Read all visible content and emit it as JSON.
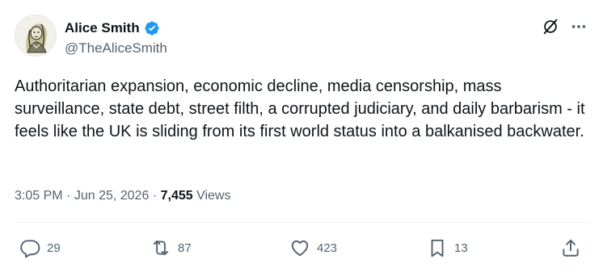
{
  "author": {
    "display_name": "Alice Smith",
    "handle": "@TheAliceSmith",
    "verified": true,
    "verified_color": "#1d9bf0"
  },
  "tweet": {
    "text": "Authoritarian expansion, economic decline, media censorship, mass surveillance, state debt, street filth, a corrupted judiciary, and daily barbarism - it feels like the UK is sliding from its first world status into a balkanised backwater.",
    "time": "3:05 PM",
    "separator": "·",
    "date": "Jun 25, 2026",
    "views_count": "7,455",
    "views_label": "Views"
  },
  "actions": {
    "replies": "29",
    "reposts": "87",
    "likes": "423",
    "bookmarks": "13"
  },
  "icons": {
    "grok": "grok-icon",
    "more": "more-icon",
    "reply": "reply-icon",
    "repost": "repost-icon",
    "like": "heart-icon",
    "bookmark": "bookmark-icon",
    "share": "share-icon"
  },
  "colors": {
    "text_primary": "#0f1419",
    "text_secondary": "#536471",
    "divider": "#eff3f4"
  }
}
